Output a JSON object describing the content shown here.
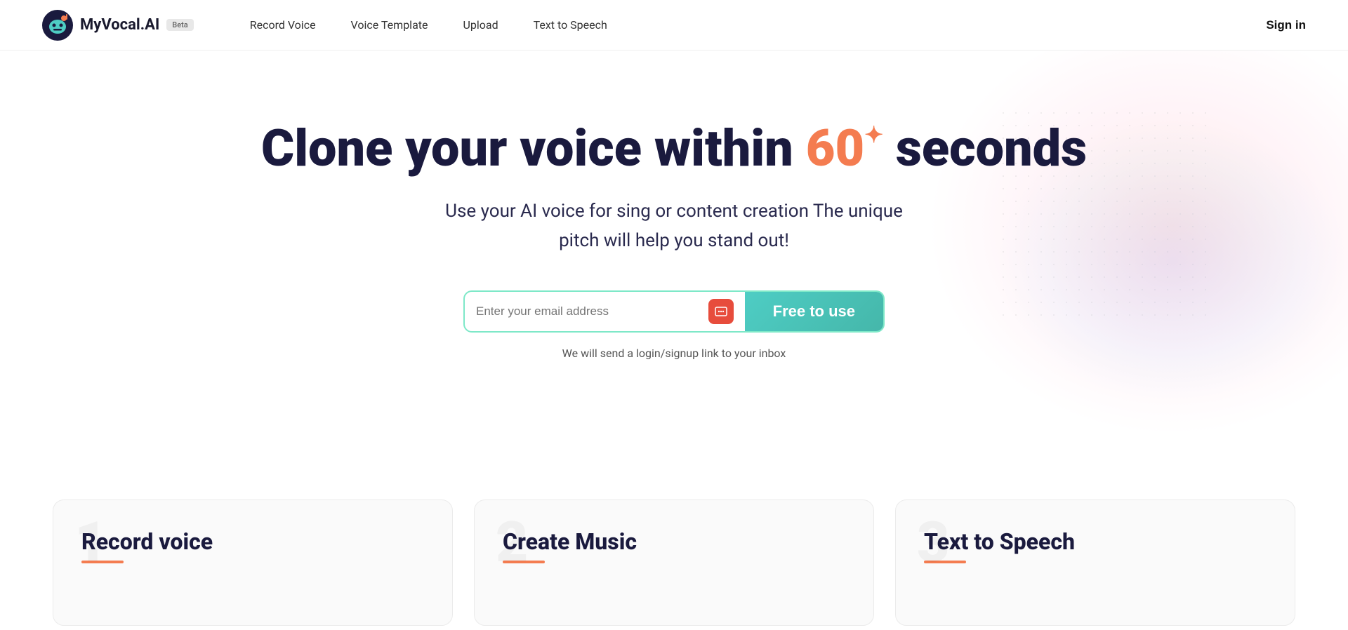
{
  "header": {
    "logo_text": "MyVocal.AI",
    "beta_label": "Beta",
    "nav": [
      {
        "label": "Record Voice",
        "id": "nav-record-voice"
      },
      {
        "label": "Voice Template",
        "id": "nav-voice-template"
      },
      {
        "label": "Upload",
        "id": "nav-upload"
      },
      {
        "label": "Text to Speech",
        "id": "nav-text-to-speech"
      }
    ],
    "sign_in": "Sign in"
  },
  "hero": {
    "title_part1": "Clone your voice within ",
    "title_number": "60",
    "title_part2": " seconds",
    "subtitle": "Use your AI voice for sing or content creation The unique pitch will help you stand out!",
    "email_placeholder": "Enter your email address",
    "free_btn_label": "Free to use",
    "helper_text": "We will send a login/signup link to your inbox"
  },
  "cards": [
    {
      "number": "1",
      "title": "Record voice",
      "id": "card-record-voice"
    },
    {
      "number": "2",
      "title": "Create Music",
      "id": "card-create-music"
    },
    {
      "number": "3",
      "title": "Text to Speech",
      "id": "card-text-to-speech"
    }
  ],
  "colors": {
    "accent_orange": "#f47c50",
    "accent_teal": "#4ecdc4",
    "dark_navy": "#1a1a3e",
    "beta_bg": "#e8e8e8"
  }
}
